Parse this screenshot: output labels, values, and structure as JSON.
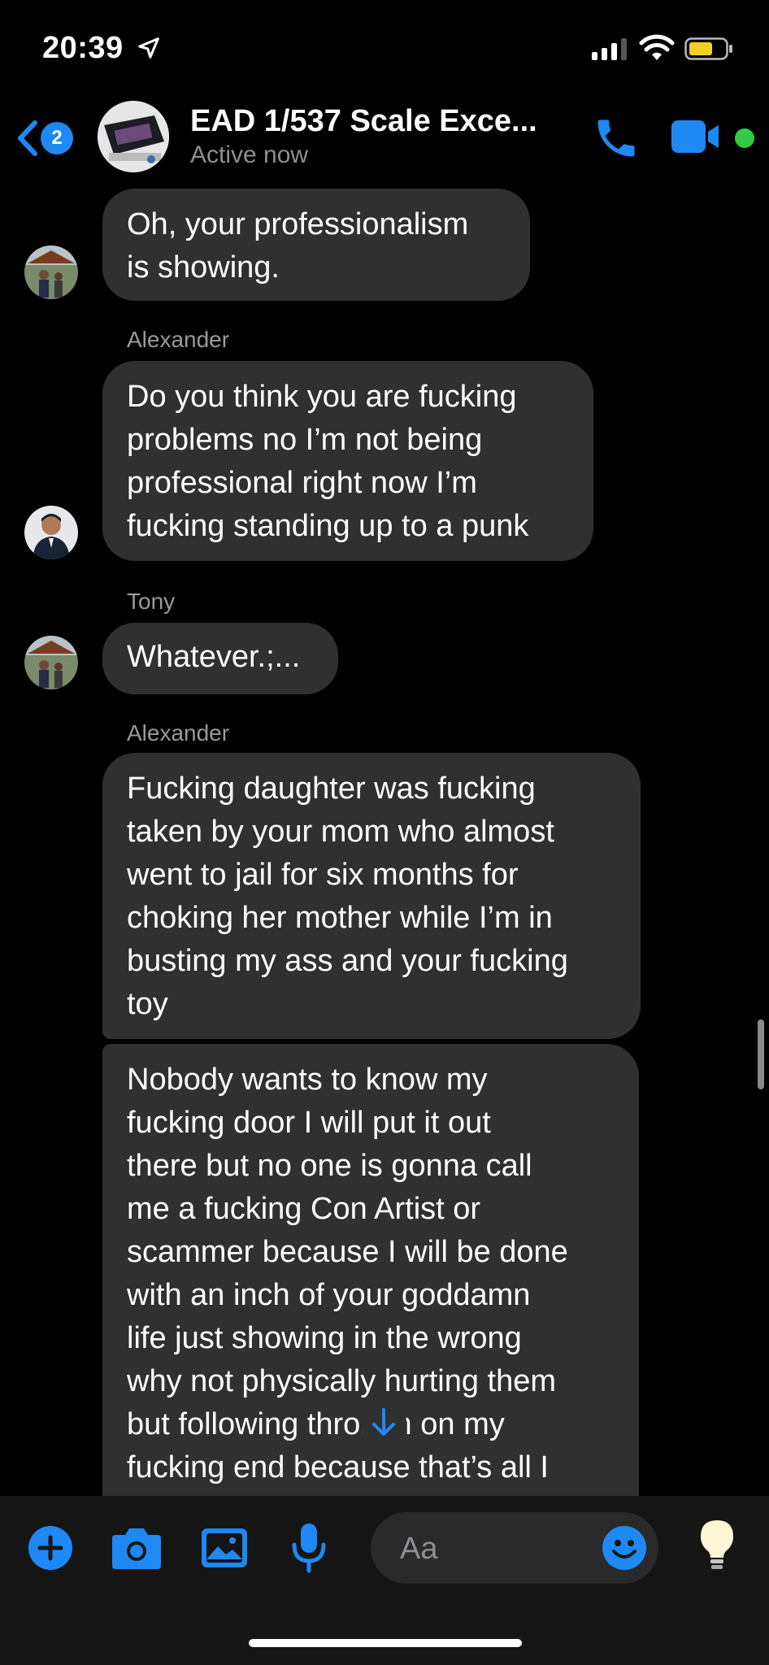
{
  "status_bar": {
    "time": "20:39"
  },
  "header": {
    "back_badge": "2",
    "title": "EAD 1/537  Scale Exce...",
    "subtitle": "Active now"
  },
  "messages": [
    {
      "sender": "",
      "text": "Oh, your professionalism\nis showing."
    },
    {
      "sender": "Alexander",
      "text": "Do you think you are fucking\nproblems no I’m not being\nprofessional right now I’m\nfucking standing up to a punk"
    },
    {
      "sender": "Tony",
      "text": "Whatever.;..."
    },
    {
      "sender": "Alexander",
      "text": "Fucking daughter was fucking\ntaken by your mom who almost\nwent to jail for six months for\nchoking her mother while I’m in\nbusting my ass and your fucking\ntoy"
    },
    {
      "sender": "",
      "text": "Nobody wants to know my\nfucking door I will put it out\nthere but no one is gonna call\nme a fucking Con Artist or\nscammer because I will be done\nwith an inch of your goddamn\nlife just showing in the wrong\nwhy not physically hurting them\nbut following through on my\nfucking end because that’s all I"
    }
  ],
  "composer": {
    "placeholder": "Aa"
  },
  "colors": {
    "accent": "#1e88f5",
    "bubble": "#303030",
    "online": "#31cc46"
  },
  "icons": [
    "location-arrow-icon",
    "signal-icon",
    "wifi-icon",
    "battery-icon",
    "back-chevron-icon",
    "phone-icon",
    "video-camera-icon",
    "plus-icon",
    "camera-icon",
    "image-icon",
    "microphone-icon",
    "emoji-icon",
    "lightbulb-icon",
    "arrow-down-icon"
  ]
}
